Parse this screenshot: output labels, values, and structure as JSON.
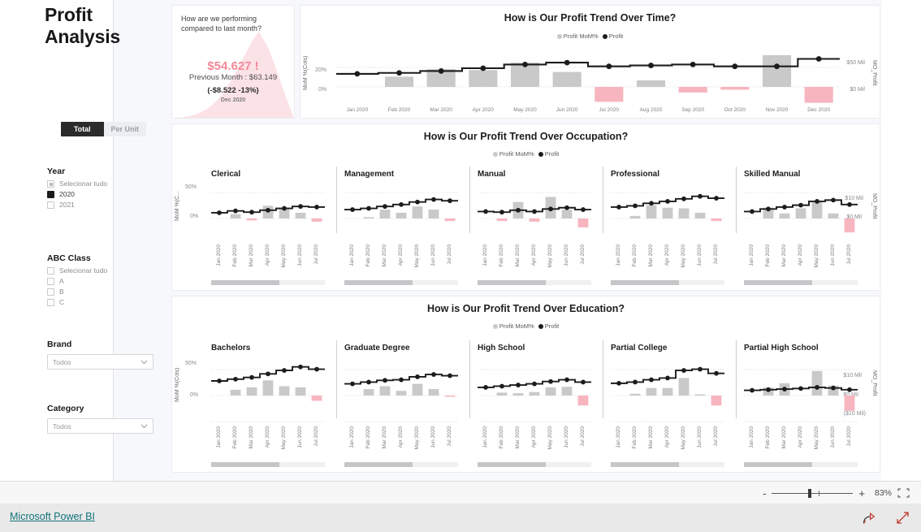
{
  "report": {
    "title": "Profit\nAnalysis",
    "title_line1": "Profit",
    "title_line2": "Analysis"
  },
  "toggle": {
    "total_label": "Total",
    "per_unit_label": "Per Unit"
  },
  "slicers": {
    "year": {
      "title": "Year",
      "items": [
        {
          "label": "Selecionar tudo",
          "state": "partial"
        },
        {
          "label": "2020",
          "state": "selected"
        },
        {
          "label": "2021",
          "state": "unselected"
        }
      ]
    },
    "abc_class": {
      "title": "ABC Class",
      "items": [
        {
          "label": "Selecionar tudo",
          "state": "unselected"
        },
        {
          "label": "A",
          "state": "unselected"
        },
        {
          "label": "B",
          "state": "unselected"
        },
        {
          "label": "C",
          "state": "unselected"
        }
      ]
    },
    "brand": {
      "title": "Brand",
      "value": "Todos"
    },
    "category": {
      "title": "Category",
      "value": "Todos"
    }
  },
  "kpi": {
    "question": "How are we performing compared to last month?",
    "value": "$54.627 !",
    "previous": "Previous Month : $63.149",
    "delta": "(-$8.522 -13%)",
    "month": "Dec 2020"
  },
  "legend": {
    "series1": "Profit MoM%",
    "series2": "Profit"
  },
  "colors": {
    "positive_bar": "#c9c9c9",
    "negative_bar": "#f7b5bf",
    "line": "#1c1c1c",
    "accent_pink": "#f2899a",
    "link": "#11737c"
  },
  "chart_data": [
    {
      "type": "bar",
      "id": "profit-trend-over-time",
      "title": "How is Our Profit Trend Over Time?",
      "xlabel": "",
      "ylabel": "MoM %(Cols)",
      "y2label": "MO_Profit",
      "legend": [
        "Profit MoM%",
        "Profit"
      ],
      "legend_position": "top",
      "grid": true,
      "categories": [
        "Jan 2020",
        "Feb 2020",
        "Mar 2020",
        "Apr 2020",
        "May 2020",
        "Jun 2020",
        "Jul 2020",
        "Aug 2020",
        "Sep 2020",
        "Oct 2020",
        "Nov 2020",
        "Dec 2020"
      ],
      "ytick_labels": [
        "20%",
        "0%"
      ],
      "ylim": [
        -20,
        40
      ],
      "y2tick_labels": [
        "$50 Mil",
        "$0 Mil"
      ],
      "y2lim": [
        0,
        60
      ],
      "series": [
        {
          "name": "Profit MoM%",
          "type": "bar",
          "values": [
            0,
            11,
            19,
            18,
            26,
            16,
            -16,
            7,
            -6,
            -3,
            34,
            -17
          ]
        },
        {
          "name": "Profit",
          "type": "step",
          "values": [
            14,
            15,
            17,
            20,
            24,
            26,
            22,
            23,
            24,
            22,
            22,
            30,
            27
          ]
        }
      ]
    },
    {
      "type": "bar",
      "id": "profit-trend-over-occupation",
      "title": "How is Our Profit Trend Over Occupation?",
      "ylabel": "MoM %(C...",
      "y2label": "MO_Profit",
      "legend": [
        "Profit MoM%",
        "Profit"
      ],
      "ytick_labels": [
        "50%",
        "0%"
      ],
      "y2tick_labels": [
        "$10 Mil",
        "$0 Mil"
      ],
      "categories": [
        "Jan 2020",
        "Feb 2020",
        "Mar 2020",
        "Apr 2020",
        "May 2020",
        "Jun 2020",
        "Jul 2020"
      ],
      "panels": [
        {
          "name": "Clerical",
          "bars": [
            0,
            7,
            -3,
            20,
            15,
            9,
            -5
          ],
          "line": [
            9,
            12,
            10,
            13,
            16,
            19,
            18
          ]
        },
        {
          "name": "Management",
          "bars": [
            0,
            2,
            14,
            9,
            19,
            14,
            -4
          ],
          "line": [
            14,
            16,
            19,
            22,
            26,
            30,
            28
          ]
        },
        {
          "name": "Manual",
          "bars": [
            0,
            -4,
            26,
            -5,
            34,
            14,
            -14
          ],
          "line": [
            11,
            10,
            13,
            11,
            15,
            17,
            14
          ]
        },
        {
          "name": "Professional",
          "bars": [
            0,
            4,
            21,
            17,
            16,
            9,
            -4
          ],
          "line": [
            18,
            20,
            24,
            27,
            31,
            35,
            32
          ]
        },
        {
          "name": "Skilled Manual",
          "bars": [
            0,
            17,
            8,
            16,
            28,
            8,
            -22
          ],
          "line": [
            11,
            15,
            18,
            21,
            27,
            29,
            22
          ]
        }
      ],
      "scroll": {
        "visible": true,
        "thumb_fraction": 0.6
      }
    },
    {
      "type": "bar",
      "id": "profit-trend-over-education",
      "title": "How is Our Profit Trend Over Education?",
      "ylabel": "MoM %(Cols)",
      "y2label": "MO_Profit",
      "legend": [
        "Profit MoM%",
        "Profit"
      ],
      "ytick_labels": [
        "50%",
        "0%"
      ],
      "y2tick_labels": [
        "$10 Mil",
        "$0 Mil",
        "($10 Mil)"
      ],
      "categories": [
        "Jan 2020",
        "Feb 2020",
        "Mar 2020",
        "Apr 2020",
        "May 2020",
        "Jun 2020",
        "Jul 2020"
      ],
      "panels": [
        {
          "name": "Bachelors",
          "bars": [
            0,
            10,
            14,
            26,
            16,
            14,
            -9
          ],
          "line": [
            25,
            28,
            31,
            37,
            43,
            49,
            45
          ]
        },
        {
          "name": "Graduate Degree",
          "bars": [
            0,
            11,
            16,
            8,
            20,
            11,
            -1
          ],
          "line": [
            20,
            23,
            26,
            27,
            32,
            36,
            34
          ]
        },
        {
          "name": "High School",
          "bars": [
            0,
            5,
            4,
            6,
            14,
            15,
            -17
          ],
          "line": [
            14,
            16,
            18,
            20,
            24,
            27,
            23
          ]
        },
        {
          "name": "Partial College",
          "bars": [
            0,
            3,
            13,
            13,
            30,
            2,
            -17
          ],
          "line": [
            21,
            23,
            27,
            30,
            43,
            45,
            38
          ]
        },
        {
          "name": "Partial High School",
          "bars": [
            0,
            14,
            21,
            0,
            42,
            17,
            -26
          ],
          "line": [
            9,
            10,
            11,
            12,
            14,
            13,
            10
          ]
        }
      ],
      "scroll": {
        "visible": true,
        "thumb_fraction": 0.6
      }
    }
  ],
  "statusbar": {
    "zoom_percent": "83%",
    "minus": "-",
    "plus": "+",
    "fit_icon": "fit-to-page-icon"
  },
  "footer": {
    "brand": "Microsoft Power BI",
    "share_icon": "share-icon",
    "fullscreen_icon": "fullscreen-icon"
  }
}
